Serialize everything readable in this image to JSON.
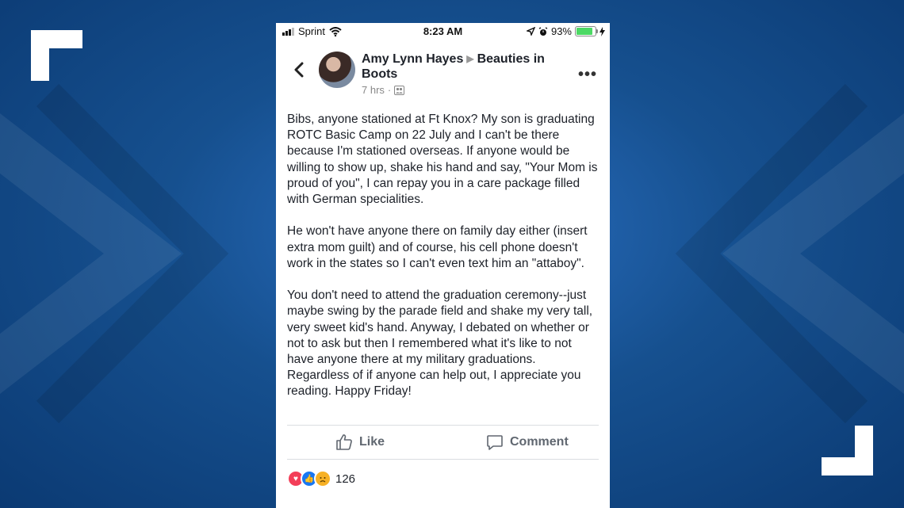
{
  "status_bar": {
    "carrier": "Sprint",
    "time": "8:23 AM",
    "battery_percent": "93%",
    "battery_level": 0.93
  },
  "post": {
    "author": "Amy Lynn Hayes",
    "group": "Beauties in Boots",
    "time_ago": "7 hrs",
    "audience_icon": "group-icon",
    "paragraphs": [
      "Bibs, anyone stationed at Ft Knox? My son is graduating ROTC Basic Camp on 22 July and I can't be there because I'm stationed overseas. If anyone would be willing to show up, shake his hand and say, \"Your Mom is proud of you\", I can repay you in a care package filled with German specialities.",
      "He won't have anyone there on family day either (insert extra mom guilt) and of course, his cell phone doesn't work in the states so I can't even text him an \"attaboy\".",
      "You don't need to attend the graduation ceremony--just maybe swing by the parade field and shake my very tall, very sweet kid's hand. Anyway, I debated on whether or not to ask but then I remembered what it's like to not have anyone there at my military graduations. Regardless of if anyone can help out, I appreciate you reading. Happy Friday!"
    ]
  },
  "actions": {
    "like_label": "Like",
    "comment_label": "Comment"
  },
  "reactions": {
    "types": [
      "love",
      "like",
      "sad"
    ],
    "count": "126"
  },
  "colors": {
    "background": "#16508f",
    "battery": "#4cd964",
    "love": "#f33e58",
    "like": "#1877f2",
    "sad": "#f7b125"
  }
}
